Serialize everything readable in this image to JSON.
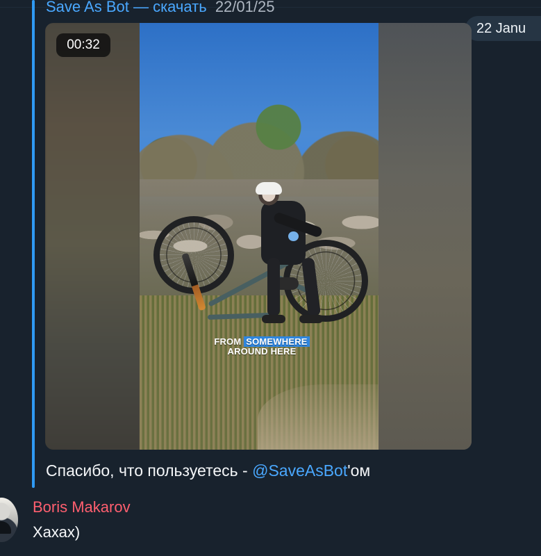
{
  "chat": {
    "forwarded_post": {
      "sender_name": "Save As Bot — скачать",
      "sender_date": "22/01/25",
      "date_pill": "22 Janu",
      "video": {
        "duration": "00:32",
        "caption_line_1_prefix": "FROM",
        "caption_line_1_highlight": "SOMEWHERE",
        "caption_line_2": "AROUND HERE"
      },
      "message_prefix": "Спасибо, что пользуетесь - ",
      "mention": "@SaveAsBot",
      "message_suffix": "'ом"
    },
    "reply": {
      "author": "Boris Makarov",
      "text": "Хахах)"
    }
  },
  "colors": {
    "background": "#18222d",
    "quote_accent": "#2f9af3",
    "link": "#4aa8ff",
    "author": "#ff5f6f",
    "caption_highlight": "#2f86df"
  }
}
